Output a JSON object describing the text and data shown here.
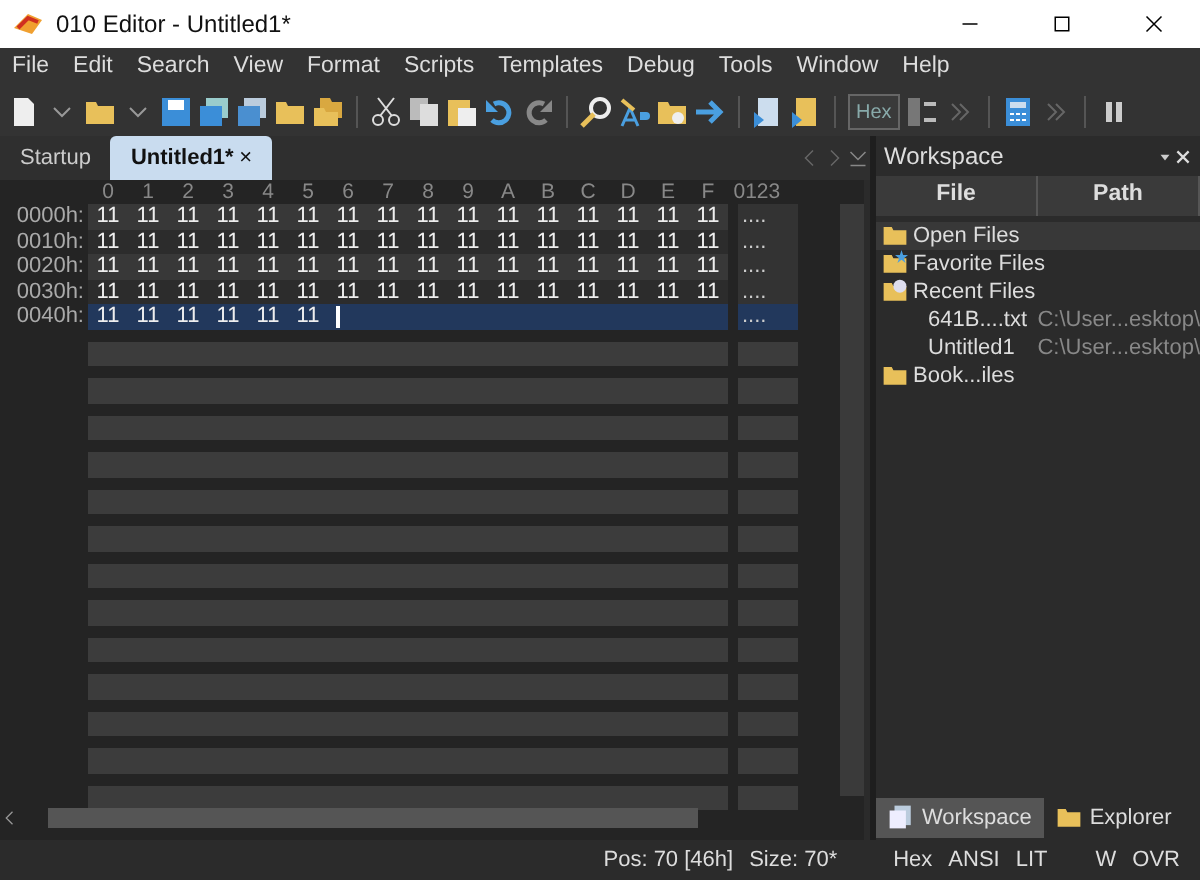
{
  "window": {
    "title": "010 Editor - Untitled1*"
  },
  "menu": [
    "File",
    "Edit",
    "Search",
    "View",
    "Format",
    "Scripts",
    "Templates",
    "Debug",
    "Tools",
    "Window",
    "Help"
  ],
  "toolbar": {
    "hex_button": "Hex"
  },
  "tabs": [
    {
      "label": "Startup",
      "selected": false
    },
    {
      "label": "Untitled1*",
      "selected": true,
      "close": "×"
    }
  ],
  "hex": {
    "columns": [
      "0",
      "1",
      "2",
      "3",
      "4",
      "5",
      "6",
      "7",
      "8",
      "9",
      "A",
      "B",
      "C",
      "D",
      "E",
      "F"
    ],
    "text_header": "0123",
    "rows": [
      {
        "address": "0000h:",
        "bytes": [
          "11",
          "11",
          "11",
          "11",
          "11",
          "11",
          "11",
          "11",
          "11",
          "11",
          "11",
          "11",
          "11",
          "11",
          "11",
          "11"
        ],
        "text": "....",
        "selected": false
      },
      {
        "address": "0010h:",
        "bytes": [
          "11",
          "11",
          "11",
          "11",
          "11",
          "11",
          "11",
          "11",
          "11",
          "11",
          "11",
          "11",
          "11",
          "11",
          "11",
          "11"
        ],
        "text": "....",
        "selected": false
      },
      {
        "address": "0020h:",
        "bytes": [
          "11",
          "11",
          "11",
          "11",
          "11",
          "11",
          "11",
          "11",
          "11",
          "11",
          "11",
          "11",
          "11",
          "11",
          "11",
          "11"
        ],
        "text": "....",
        "selected": false
      },
      {
        "address": "0030h:",
        "bytes": [
          "11",
          "11",
          "11",
          "11",
          "11",
          "11",
          "11",
          "11",
          "11",
          "11",
          "11",
          "11",
          "11",
          "11",
          "11",
          "11"
        ],
        "text": "....",
        "selected": false
      },
      {
        "address": "0040h:",
        "bytes": [
          "11",
          "11",
          "11",
          "11",
          "11",
          "11"
        ],
        "text": "....",
        "selected": true
      }
    ]
  },
  "workspace": {
    "title": "Workspace",
    "columns": [
      "File",
      "Path"
    ],
    "tree": [
      {
        "label": "Open Files",
        "kind": "open"
      },
      {
        "label": "Favorite Files",
        "kind": "favorite"
      },
      {
        "label": "Recent Files",
        "kind": "recent",
        "children": [
          {
            "label": "641B....txt",
            "path": "C:\\User...esktop\\"
          },
          {
            "label": "Untitled1",
            "path": "C:\\User...esktop\\"
          }
        ]
      },
      {
        "label": "Book...iles",
        "kind": "bookmark"
      }
    ],
    "bottom_tabs": [
      {
        "label": "Workspace",
        "selected": true
      },
      {
        "label": "Explorer",
        "selected": false
      }
    ]
  },
  "status_bar": [
    "Pos: 70 [46h]",
    "Size: 70*",
    "Hex",
    "ANSI",
    "LIT",
    "W",
    "OVR"
  ]
}
